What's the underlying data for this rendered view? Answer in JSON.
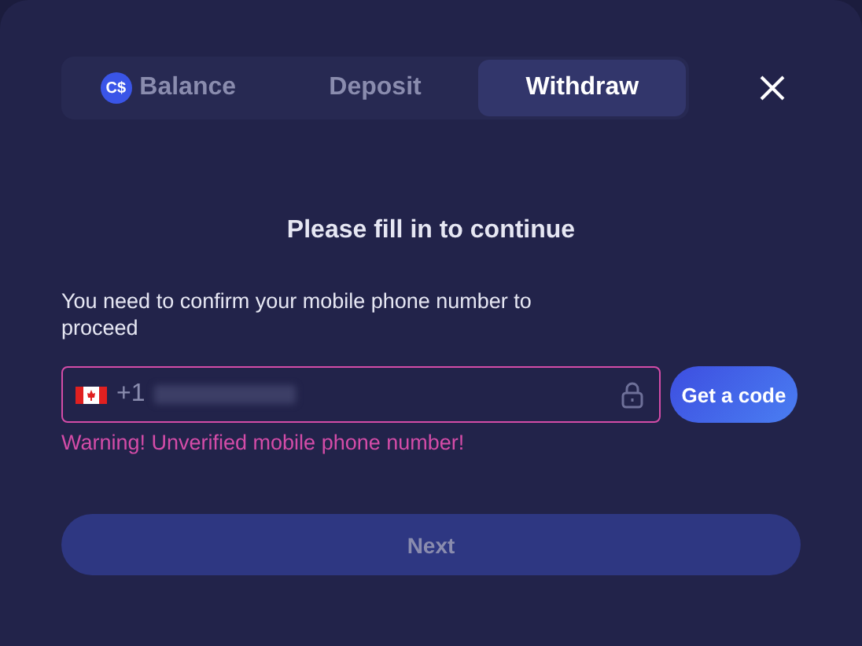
{
  "tabs": [
    {
      "label": "Balance",
      "icon_text": "C$",
      "selected": false
    },
    {
      "label": "Deposit",
      "selected": false
    },
    {
      "label": "Withdraw",
      "selected": true
    }
  ],
  "heading": "Please fill in to continue",
  "instruction": "You need to confirm your mobile phone number to proceed",
  "phone": {
    "country_code": "+1",
    "invalid": true,
    "locked": true
  },
  "get_code_button": "Get a code",
  "warning": "Warning! Unverified mobile phone number!",
  "next_button": {
    "label": "Next",
    "disabled": true
  }
}
